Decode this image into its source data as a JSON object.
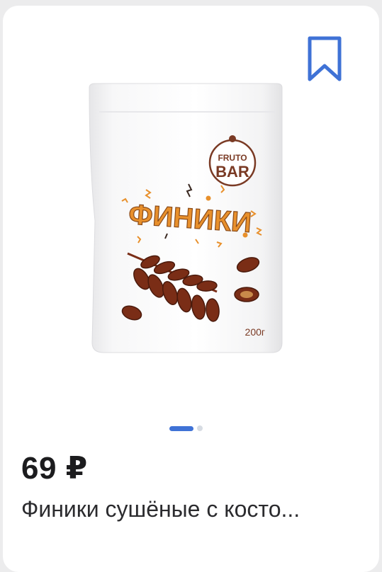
{
  "product": {
    "price": "69 ₽",
    "title": "Финики сушёные с косто...",
    "image": {
      "brand_line1": "FRUTO",
      "brand_line2": "BAR",
      "name": "ФИНИКИ",
      "weight": "200г"
    },
    "gallery": {
      "active_index": 0,
      "count": 2
    }
  },
  "icons": {
    "bookmark": "bookmark-icon"
  },
  "colors": {
    "accent": "#3f72d6",
    "package_orange": "#e8902c",
    "date_brown": "#7a2d16"
  }
}
